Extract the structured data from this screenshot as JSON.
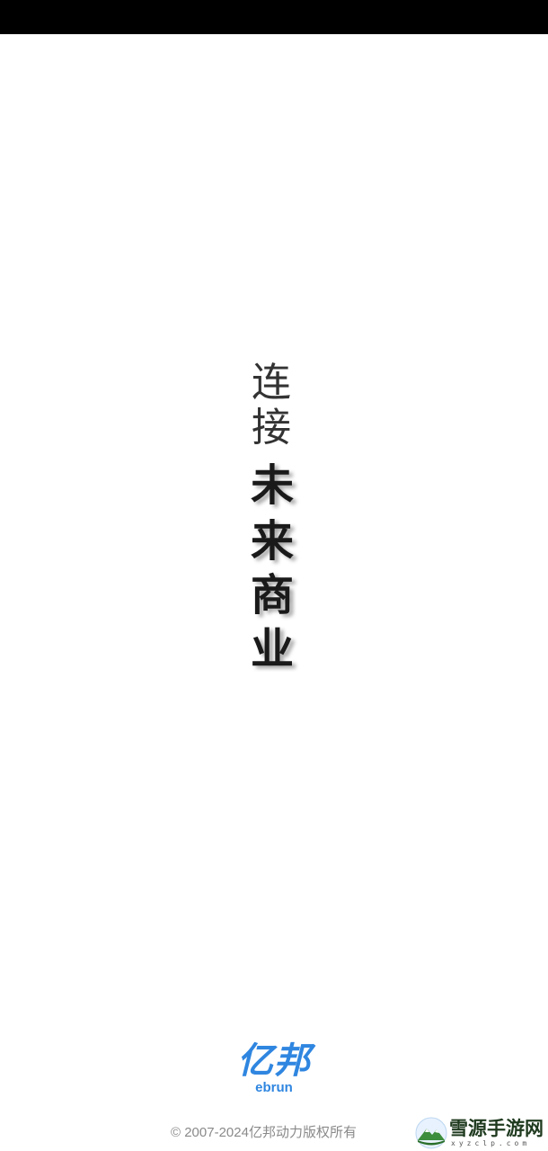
{
  "status_bar": {},
  "slogan": {
    "light_chars": [
      "连",
      "接"
    ],
    "bold_chars": [
      "未",
      "来",
      "商",
      "业"
    ]
  },
  "brand": {
    "name_cn": "亿邦",
    "name_en": "ebrun",
    "color": "#2f86e0"
  },
  "footer": {
    "copyright": "© 2007-2024亿邦动力版权所有"
  },
  "watermark": {
    "title": "雪源手游网",
    "subtitle": "xyzclp.com",
    "icon": "mountain-logo-icon"
  }
}
